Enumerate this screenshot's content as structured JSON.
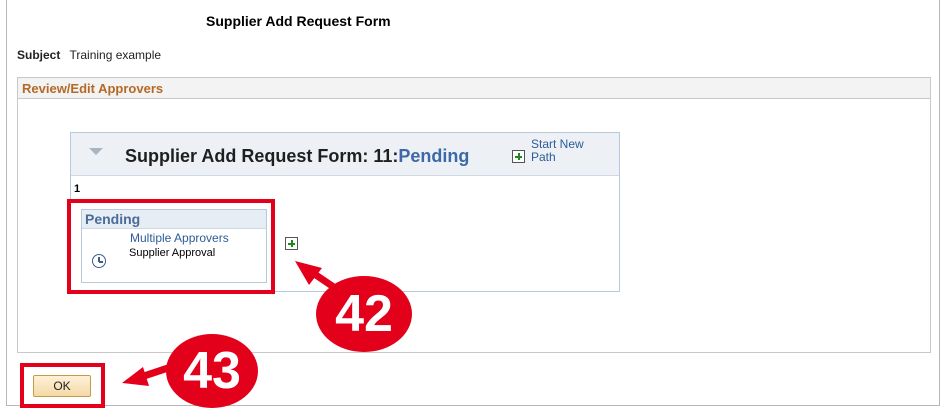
{
  "page": {
    "title": "Supplier Add Request Form",
    "subject_label": "Subject",
    "subject_value": "Training example"
  },
  "section": {
    "title": "Review/Edit Approvers"
  },
  "approval_path": {
    "title_prefix": "Supplier Add Request Form: 11:",
    "status": "Pending",
    "start_new_path": "Start New Path",
    "step_number": "1",
    "step": {
      "header": "Pending",
      "approver_link": "Multiple Approvers",
      "approval_label": "Supplier Approval"
    }
  },
  "footer": {
    "ok_label": "OK"
  },
  "callouts": {
    "first": "42",
    "second": "43"
  },
  "colors": {
    "callout_red": "#e3001b",
    "section_title": "#b46a26",
    "link_blue": "#2d5c96"
  },
  "icons": [
    "collapse-triangle-icon",
    "add-path-plus-icon",
    "clock-icon",
    "add-step-plus-icon"
  ]
}
